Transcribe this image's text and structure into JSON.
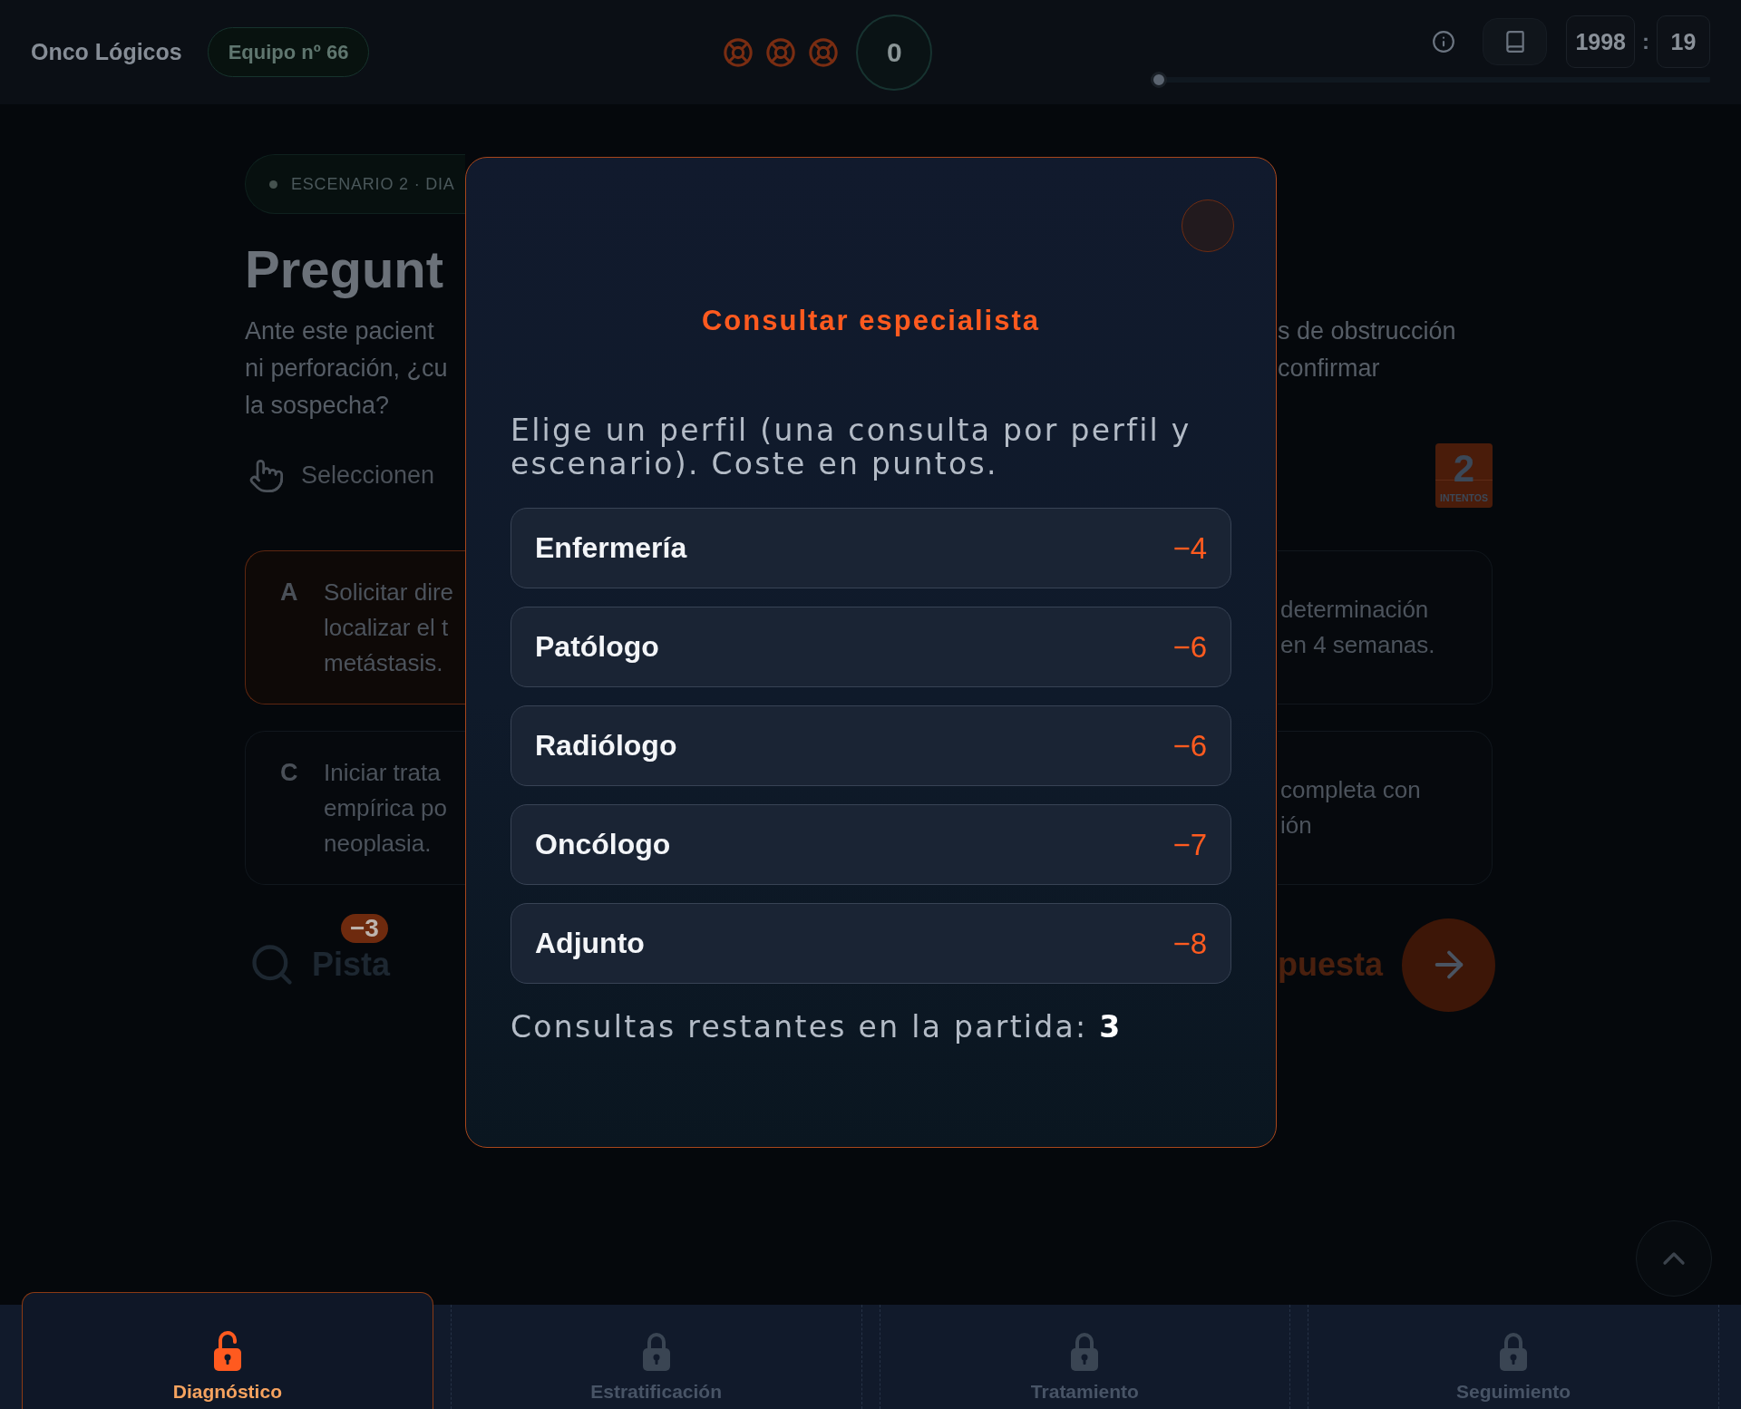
{
  "top_bar": {
    "brand": "Onco Lógicos",
    "team": "Equipo nº 66",
    "lifelines": [
      {
        "used": false
      },
      {
        "used": false
      },
      {
        "used": false
      }
    ],
    "score": "0",
    "timer": {
      "minutes": "1998",
      "separator": ":",
      "seconds": "19"
    },
    "progress": {
      "level": 0
    }
  },
  "scenario": {
    "tag": "ESCENARIO 2 · DIA",
    "title": "Pregunt",
    "question_left": [
      "Ante este pacient",
      "ni perforación, ¿cu",
      "la sospecha?"
    ],
    "question_right": [
      "s de obstrucción",
      "confirmar"
    ],
    "hint": "Seleccionen",
    "attempts": {
      "count": "2",
      "label": "INTENTOS"
    }
  },
  "option_rows": [
    {
      "left": {
        "letter": "A",
        "lines": [
          "Solicitar dire",
          "localizar el t",
          "metástasis."
        ],
        "selected": true
      },
      "right": {
        "lines": [
          "determinación",
          "en 4 semanas."
        ],
        "selected": false
      }
    },
    {
      "left": {
        "letter": "C",
        "lines": [
          "Iniciar trata",
          "empírica po",
          "neoplasia."
        ],
        "selected": false
      },
      "right": {
        "lines": [
          "completa con",
          "ión"
        ],
        "selected": false
      }
    }
  ],
  "hint_button": {
    "label": "Pista",
    "cost": "−3"
  },
  "submit": {
    "label": "puesta"
  },
  "modal": {
    "title": "Consultar especialista",
    "description": "Elige un perfil (una consulta por perfil y escenario). Coste en puntos.",
    "specialists": [
      {
        "name": "Enfermería",
        "cost": "−4"
      },
      {
        "name": "Patólogo",
        "cost": "−6"
      },
      {
        "name": "Radiólogo",
        "cost": "−6"
      },
      {
        "name": "Oncólogo",
        "cost": "−7"
      },
      {
        "name": "Adjunto",
        "cost": "−8"
      }
    ],
    "footer": "Consultas restantes en la partida: **3**"
  },
  "bottom_tabs": [
    {
      "label": "Diagnóstico",
      "selected": true,
      "locked": false
    },
    {
      "label": "Estratificación",
      "selected": false,
      "locked": true
    },
    {
      "label": "Tratamiento",
      "selected": false,
      "locked": true
    },
    {
      "label": "Seguimiento",
      "selected": false,
      "locked": true
    }
  ]
}
